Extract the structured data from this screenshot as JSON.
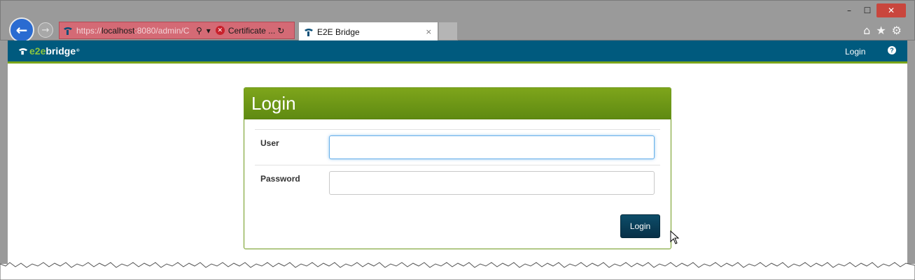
{
  "browser": {
    "url_prefix": "https://",
    "url_host": "localhost",
    "url_rest": ":8080/admin/C",
    "address_icons": [
      "search-icon",
      "dropdown-icon"
    ],
    "refresh_icon": "refresh-icon",
    "certificate_label": "Certificate ...",
    "tab_title": "E2E Bridge",
    "tab_close": "×",
    "window_controls": [
      "–",
      "☐",
      "✕"
    ],
    "right_icons": [
      "home-icon",
      "star-icon",
      "gear-icon"
    ]
  },
  "site": {
    "brand_e2e": "e2e",
    "brand_bridge": "bridge",
    "brand_mark": "®",
    "nav_login": "Login",
    "help": "?"
  },
  "login_panel": {
    "title": "Login",
    "user_label": "User",
    "user_value": "",
    "password_label": "Password",
    "password_value": "",
    "submit_label": "Login"
  },
  "colors": {
    "header_bg": "#005a7e",
    "panel_green": "#7ea51b",
    "button_bg": "#0d4d69",
    "address_error": "#d46a75"
  }
}
